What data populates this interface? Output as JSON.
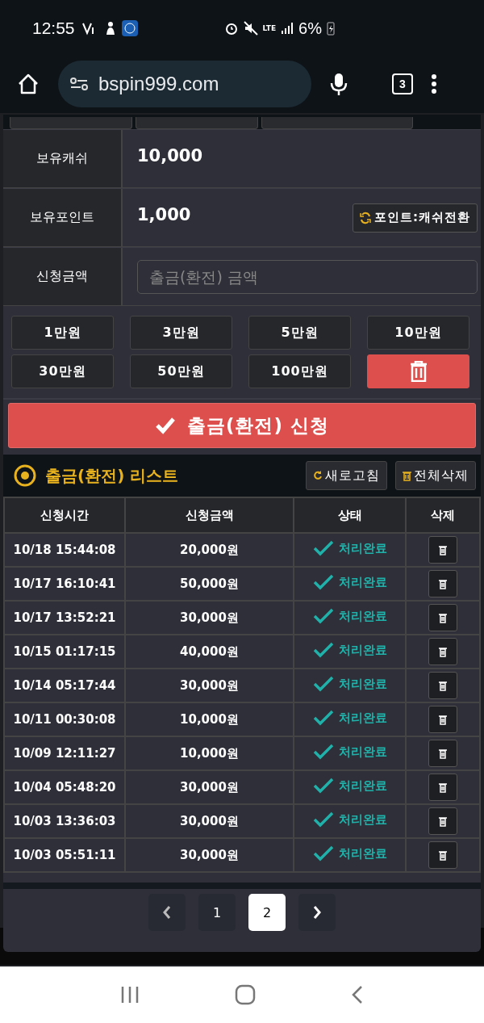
{
  "status_bar": {
    "time": "12:55",
    "network": "LTE",
    "battery": "6%"
  },
  "browser": {
    "url": "bspin999.com",
    "tab_count": "3"
  },
  "balance": [
    {
      "label": "보유캐쉬",
      "value": "10,000"
    },
    {
      "label": "보유포인트",
      "value": "1,000",
      "action": "포인트:캐쉬전환"
    }
  ],
  "amount_field": {
    "label": "신청금액",
    "placeholder": "출금(환전) 금액"
  },
  "quick_amounts": [
    "1만원",
    "3만원",
    "5만원",
    "10만원",
    "30만원",
    "50만원",
    "100만원"
  ],
  "submit": "출금(환전) 신청",
  "list": {
    "title": "출금(환전) 리스트",
    "refresh": "새로고침",
    "delete_all": "전체삭제"
  },
  "table": {
    "columns": [
      "신청시간",
      "신청금액",
      "상태",
      "삭제"
    ],
    "rows": [
      {
        "time": "10/18 15:44:08",
        "amount": "20,000원",
        "status": "처리완료"
      },
      {
        "time": "10/17 16:10:41",
        "amount": "50,000원",
        "status": "처리완료"
      },
      {
        "time": "10/17 13:52:21",
        "amount": "30,000원",
        "status": "처리완료"
      },
      {
        "time": "10/15 01:17:15",
        "amount": "40,000원",
        "status": "처리완료"
      },
      {
        "time": "10/14 05:17:44",
        "amount": "30,000원",
        "status": "처리완료"
      },
      {
        "time": "10/11 00:30:08",
        "amount": "10,000원",
        "status": "처리완료"
      },
      {
        "time": "10/09 12:11:27",
        "amount": "10,000원",
        "status": "처리완료"
      },
      {
        "time": "10/04 05:48:20",
        "amount": "30,000원",
        "status": "처리완료"
      },
      {
        "time": "10/03 13:36:03",
        "amount": "30,000원",
        "status": "처리완료"
      },
      {
        "time": "10/03 05:51:11",
        "amount": "30,000원",
        "status": "처리완료"
      }
    ]
  },
  "pagination": [
    {
      "label": "1",
      "selected": false
    },
    {
      "label": "2",
      "selected": true
    }
  ]
}
